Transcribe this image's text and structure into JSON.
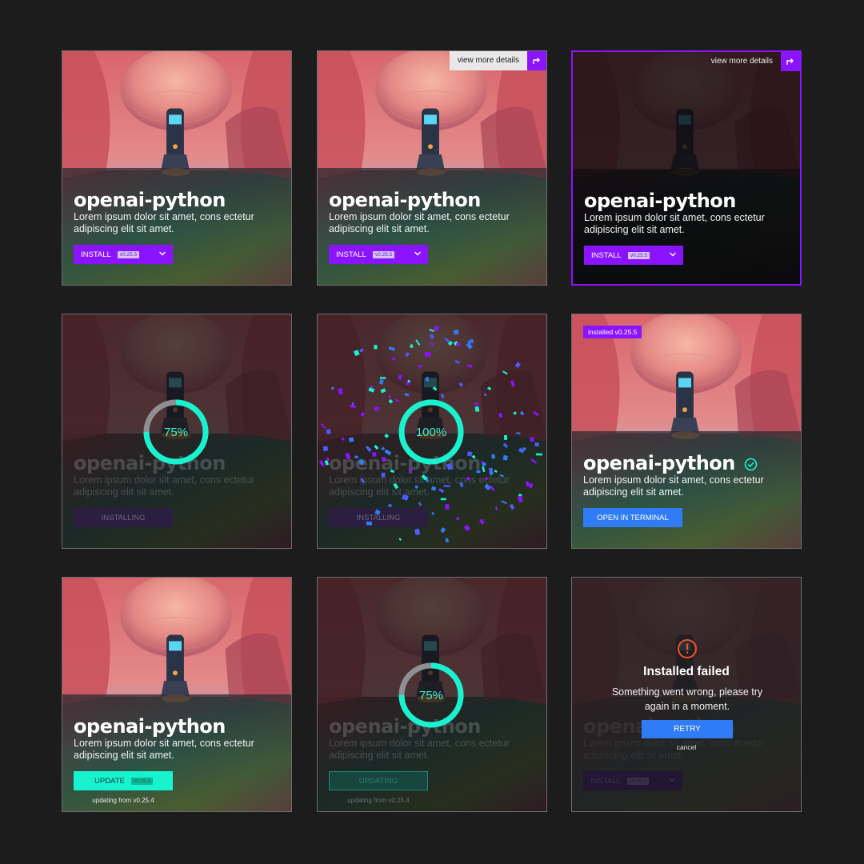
{
  "package": {
    "name": "openai-python",
    "description": "Lorem ipsum dolor sit amet, cons ectetur adipiscing elit sit amet.",
    "version_badge": "v0.25.5"
  },
  "view_more_label": "view more details",
  "cards": {
    "install_default": {
      "button_label": "INSTALL"
    },
    "install_hover": {
      "button_label": "INSTALL"
    },
    "install_selected": {
      "button_label": "INSTALL"
    },
    "installing_75": {
      "progress_label": "75%",
      "progress": 0.75,
      "button_label": "INSTALLING"
    },
    "installing_100": {
      "progress_label": "100%",
      "progress": 1.0,
      "button_label": "INSTALLING"
    },
    "installed": {
      "status_badge": "installed v0.25.5",
      "button_label": "OPEN IN TERMINAL"
    },
    "update": {
      "button_label": "UPDATE",
      "note": "updating from v0.25.4"
    },
    "updating": {
      "progress_label": "75%",
      "progress": 0.75,
      "button_label": "UPDATING",
      "note": "updating from v0.25.4"
    },
    "failed": {
      "title": "Installed failed",
      "message": "Something went wrong, please try again in a moment.",
      "retry_label": "RETRY",
      "cancel_label": "cancel",
      "button_label": "INSTALL"
    }
  },
  "colors": {
    "background": "#1c1c1d",
    "accent_purple": "#8a14ff",
    "accent_teal": "#18f3cf",
    "accent_blue": "#2f7cf6",
    "error_orange": "#f2521f"
  }
}
